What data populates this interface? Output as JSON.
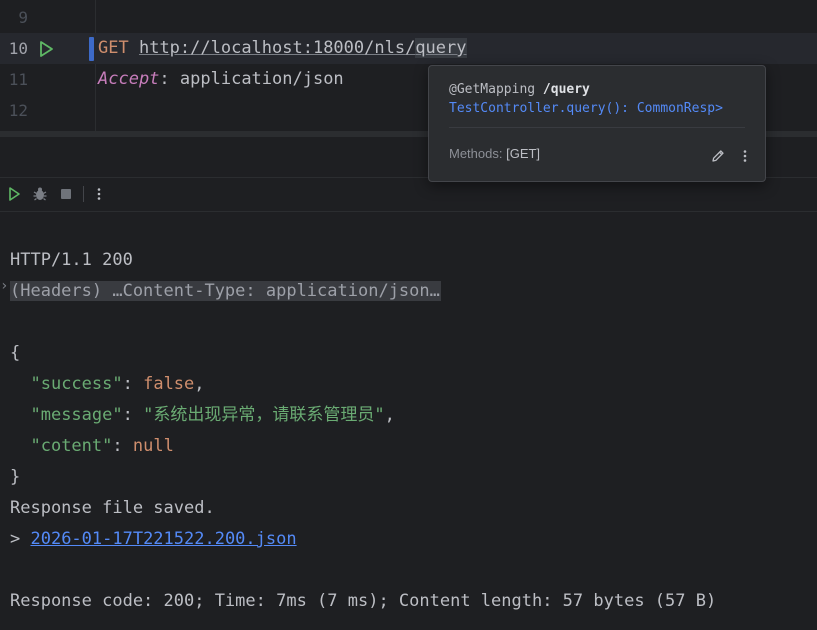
{
  "editor": {
    "lines": [
      {
        "num": "9"
      },
      {
        "num": "10",
        "method": "GET",
        "url_prefix": "http://localhost:18000/nls/",
        "url_highlight": "query"
      },
      {
        "num": "11",
        "header_name": "Accept",
        "header_sep": ": ",
        "header_value": "application/json"
      },
      {
        "num": "12"
      }
    ]
  },
  "popup": {
    "annotation": "@GetMapping ",
    "path": "/query",
    "signature": "TestController.query(): CommonResp>",
    "methods_label": "Methods: ",
    "methods_value": "[GET]",
    "icons": [
      "edit-icon",
      "more-vertical-icon"
    ]
  },
  "toolbar": {
    "icons": [
      "run-icon",
      "debug-icon",
      "stop-icon",
      "more-vertical-icon"
    ]
  },
  "output": {
    "status_line": "HTTP/1.1 200",
    "headers_fold": "(Headers) …Content-Type: application/json…",
    "open_brace": "{",
    "fields": [
      {
        "indent": "  ",
        "key": "\"success\"",
        "colon": ": ",
        "value": "false",
        "value_type": "kw",
        "comma": ","
      },
      {
        "indent": "  ",
        "key": "\"message\"",
        "colon": ": ",
        "value": "\"系统出现异常，请联系管理员\"",
        "value_type": "str",
        "comma": ","
      },
      {
        "indent": "  ",
        "key": "\"cotent\"",
        "colon": ": ",
        "value": "null",
        "value_type": "kw",
        "comma": ""
      }
    ],
    "close_brace": "}",
    "saved_text": "Response file saved.",
    "file_prefix": "> ",
    "file_link": "2026-01-17T221522.200.json",
    "summary": "Response code: 200; Time: 7ms (7 ms); Content length: 57 bytes (57 B)"
  },
  "colors": {
    "background": "#1e1f22",
    "keyword": "#cf8e6d",
    "string": "#6aab73",
    "header_name": "#c77dbb",
    "link": "#548af7",
    "run_green": "#5fb865"
  }
}
